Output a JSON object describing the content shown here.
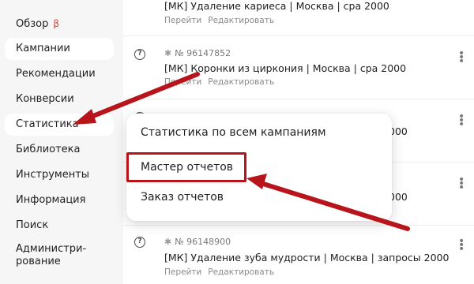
{
  "colors": {
    "accent_red": "#b8141c",
    "beta": "#e33a2f",
    "sidebar_bg": "#f6f6f6"
  },
  "sidebar": {
    "items": [
      {
        "label": "Обзор",
        "badge": "β"
      },
      {
        "label": "Кампании"
      },
      {
        "label": "Рекомендации"
      },
      {
        "label": "Конверсии"
      },
      {
        "label": "Статистика"
      },
      {
        "label": "Библиотека"
      },
      {
        "label": "Инструменты"
      },
      {
        "label": "Информация"
      },
      {
        "label": "Поиск"
      },
      {
        "label_line1": "Администри-",
        "label_line2": "рование"
      }
    ]
  },
  "campaigns": [
    {
      "title": "[МК] Удаление кариеса | Москва | cpa 2000",
      "link_go": "Перейти",
      "link_edit": "Редактировать"
    },
    {
      "id": "№ 96147852",
      "title": "[МК] Коронки из циркония | Москва | cpa 2000",
      "link_go": "Перейти",
      "link_edit": "Редактировать"
    },
    {
      "title_visible_tail": "000"
    },
    {
      "title_visible_tail": "000"
    },
    {
      "id": "№ 96148900",
      "title": "[МК] Удаление зуба мудрости | Москва | запросы 2000",
      "link_go": "Перейти",
      "link_edit": "Редактировать"
    }
  ],
  "icons": {
    "help": "?",
    "kebab": "⋮",
    "star": "✱"
  },
  "menu": {
    "items": [
      "Статистика по всем кампаниям",
      "Мастер отчетов",
      "Заказ отчетов"
    ]
  }
}
